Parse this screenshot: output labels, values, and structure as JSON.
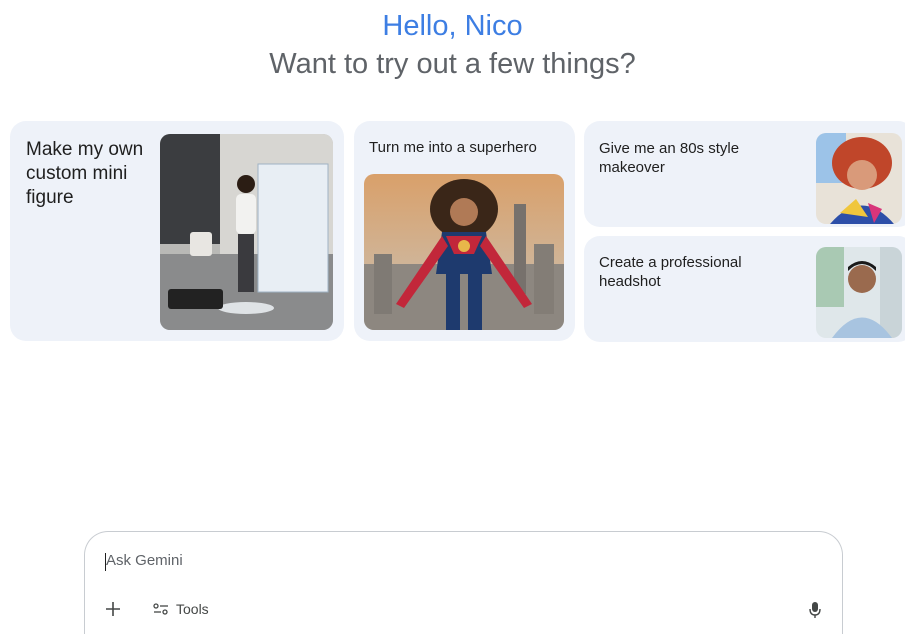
{
  "greeting": {
    "hello": "Hello, Nico",
    "subtitle": "Want to try out a few things?"
  },
  "cards": [
    {
      "label": "Make my own custom mini figure",
      "image": "mini-figure-desk-photo"
    },
    {
      "label": "Turn me into a superhero",
      "image": "superhero-woman-city-photo"
    },
    {
      "label": "Give me an 80s style makeover",
      "image": "80s-makeover-portrait"
    },
    {
      "label": "Create a professional headshot",
      "image": "professional-headshot-photo"
    }
  ],
  "input": {
    "placeholder": "Ask Gemini",
    "add_icon": "plus-icon",
    "tools_label": "Tools",
    "tools_icon": "tools-sliders-icon",
    "mic_icon": "microphone-icon"
  },
  "colors": {
    "greeting_accent": "#3d7ee3",
    "card_background": "#eef2f9",
    "subtitle": "#5f6368"
  }
}
